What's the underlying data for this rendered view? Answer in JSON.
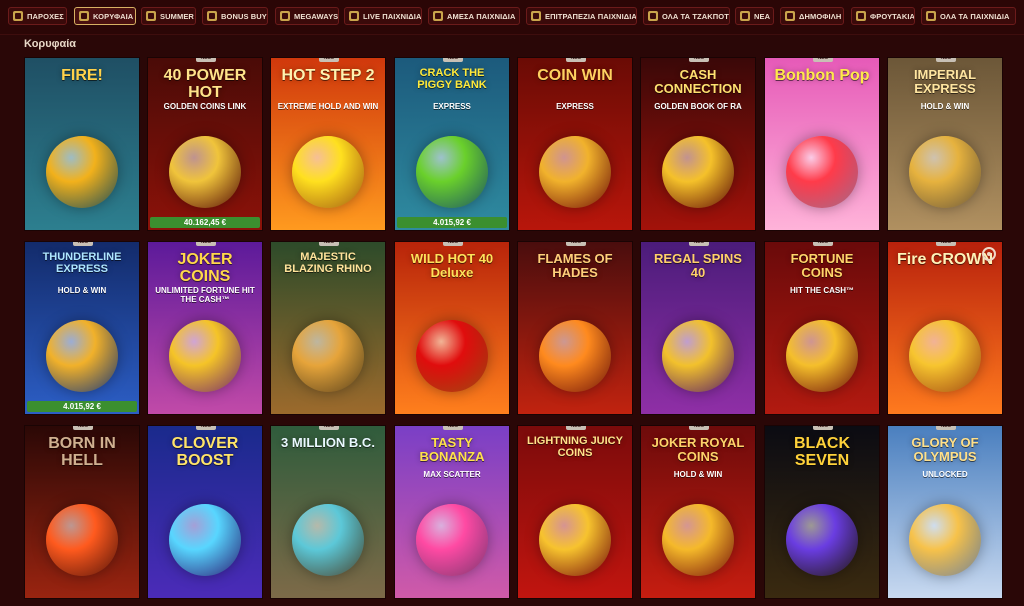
{
  "nav": {
    "tabs": [
      {
        "label": "ΠΑΡΟΧΕΣ",
        "icon": "grid-icon",
        "active": false
      },
      {
        "label": "ΚΟΡΥΦΑΙΑ",
        "icon": "crown-icon",
        "active": true
      },
      {
        "label": "SUMMER",
        "icon": "sun-icon",
        "active": false
      },
      {
        "label": "BONUS BUYS",
        "icon": "bonus-icon",
        "active": false
      },
      {
        "label": "MEGAWAYS",
        "icon": "megaways-icon",
        "active": false
      },
      {
        "label": "LIVE ΠΑΙΧΝΙΔΙΑ",
        "icon": "live-icon",
        "active": false
      },
      {
        "label": "ΑΜΕΣΑ ΠΑΙΧΝΙΔΙΑ",
        "icon": "instant-icon",
        "active": false
      },
      {
        "label": "ΕΠΙΤΡΑΠΕΖΙΑ ΠΑΙΧΝΙΔΙΑ",
        "icon": "table-games-icon",
        "active": false
      },
      {
        "label": "ΟΛΑ ΤΑ ΤΖΑΚΠΟΤ",
        "icon": "jackpot-icon",
        "active": false
      },
      {
        "label": "ΝΕΑ",
        "icon": "new-icon",
        "active": false
      },
      {
        "label": "ΔΗΜΟΦΙΛΗ",
        "icon": "popular-icon",
        "active": false
      },
      {
        "label": "ΦΡΟΥΤΑΚΙΑ",
        "icon": "fruit-icon",
        "active": false
      },
      {
        "label": "ΟΛΑ ΤΑ ΠΑΙΧΝΙΔΙΑ",
        "icon": "all-games-icon",
        "active": false
      }
    ]
  },
  "section": {
    "title": "Κορυφαία"
  },
  "games": [
    {
      "title": "FIRE!",
      "subtitle": "",
      "badge": "",
      "jackpot": "",
      "bg": [
        "#1f4f64",
        "#2d7f8f"
      ],
      "accent": "#f2b11b",
      "title_color": "#ffd24a"
    },
    {
      "title": "40 POWER HOT",
      "subtitle": "GOLDEN COINS LINK",
      "badge": "ΝΕΟ",
      "jackpot": "40.162,45 €",
      "bg": [
        "#4a0b07",
        "#8c1209"
      ],
      "accent": "#f0c43b",
      "title_color": "#ffe38a"
    },
    {
      "title": "HOT STEP 2",
      "subtitle": "EXTREME HOLD AND WIN",
      "badge": "ΝΕΟ",
      "jackpot": "",
      "bg": [
        "#d0380c",
        "#ff9a1f"
      ],
      "accent": "#ffe01f",
      "title_color": "#fff3b0"
    },
    {
      "title": "CRACK THE PIGGY BANK",
      "subtitle": "EXPRESS",
      "badge": "ΝΕΟ",
      "jackpot": "4.015,92 €",
      "bg": [
        "#1c5a7c",
        "#2f8ba0"
      ],
      "accent": "#6ad02b",
      "title_color": "#ffea3a"
    },
    {
      "title": "COIN WIN",
      "subtitle": "EXPRESS",
      "badge": "ΝΕΟ",
      "jackpot": "",
      "bg": [
        "#6a0b05",
        "#b8160b"
      ],
      "accent": "#f1b22c",
      "title_color": "#ffd060"
    },
    {
      "title": "CASH CONNECTION",
      "subtitle": "GOLDEN BOOK OF RA",
      "badge": "ΝΕΟ",
      "jackpot": "",
      "bg": [
        "#3a0808",
        "#a3120a"
      ],
      "accent": "#f5c12a",
      "title_color": "#ffe070"
    },
    {
      "title": "Bonbon Pop",
      "subtitle": "",
      "badge": "ΝΕΟ",
      "jackpot": "",
      "bg": [
        "#e65ab8",
        "#ffb3d9"
      ],
      "accent": "#ff3b4a",
      "title_color": "#ffe94a"
    },
    {
      "title": "IMPERIAL EXPRESS",
      "subtitle": "HOLD & WIN",
      "badge": "ΝΕΟ",
      "jackpot": "",
      "bg": [
        "#6c5738",
        "#b09060"
      ],
      "accent": "#e6b23e",
      "title_color": "#ffe5a0"
    },
    {
      "title": "THUNDERLINE EXPRESS",
      "subtitle": "HOLD & WIN",
      "badge": "ΝΕΟ",
      "jackpot": "4.015,92 €",
      "bg": [
        "#132b6b",
        "#2c5ec5"
      ],
      "accent": "#f1b12a",
      "title_color": "#aee6ff"
    },
    {
      "title": "JOKER COINS",
      "subtitle": "UNLIMITED FORTUNE HIT THE CASH™",
      "badge": "ΝΕΟ",
      "jackpot": "",
      "bg": [
        "#5c1a9a",
        "#c14aa8"
      ],
      "accent": "#f5c427",
      "title_color": "#ffd84a"
    },
    {
      "title": "MAJESTIC BLAZING RHINO",
      "subtitle": "",
      "badge": "ΝΕΟ",
      "jackpot": "",
      "bg": [
        "#2d4b2a",
        "#9c6a2c"
      ],
      "accent": "#e6a43a",
      "title_color": "#ffe39a"
    },
    {
      "title": "WILD HOT 40 Deluxe",
      "subtitle": "",
      "badge": "ΝΕΟ",
      "jackpot": "",
      "bg": [
        "#b8240a",
        "#ff7f1d"
      ],
      "accent": "#e00d0d",
      "title_color": "#ffe25a"
    },
    {
      "title": "FLAMES OF HADES",
      "subtitle": "",
      "badge": "ΝΕΟ",
      "jackpot": "",
      "bg": [
        "#4a0d0d",
        "#c1230f"
      ],
      "accent": "#ff8a1e",
      "title_color": "#ffcf7a"
    },
    {
      "title": "REGAL SPINS 40",
      "subtitle": "",
      "badge": "ΝΕΟ",
      "jackpot": "",
      "bg": [
        "#4b1c7a",
        "#8f2fa6"
      ],
      "accent": "#f2c12c",
      "title_color": "#ffd06a"
    },
    {
      "title": "FORTUNE COINS",
      "subtitle": "HIT THE CASH™",
      "badge": "ΝΕΟ",
      "jackpot": "",
      "bg": [
        "#6a0a0a",
        "#b21a10"
      ],
      "accent": "#f5bf2b",
      "title_color": "#ffd56a"
    },
    {
      "title": "Fire CROWN",
      "subtitle": "",
      "badge": "ΝΕΟ",
      "jackpot": "",
      "bg": [
        "#b8210c",
        "#ff7a1e"
      ],
      "accent": "#f7c52f",
      "title_color": "#fff2b8"
    },
    {
      "title": "BORN IN HELL",
      "subtitle": "",
      "badge": "ΝΕΟ",
      "jackpot": "",
      "bg": [
        "#2b0806",
        "#9a2410"
      ],
      "accent": "#ff5a1e",
      "title_color": "#d0b090"
    },
    {
      "title": "CLOVER BOOST",
      "subtitle": "",
      "badge": "ΝΕΟ",
      "jackpot": "",
      "bg": [
        "#1a2a8c",
        "#4b2bb8"
      ],
      "accent": "#58d6ff",
      "title_color": "#ffe46a"
    },
    {
      "title": "3 MILLION B.C.",
      "subtitle": "",
      "badge": "ΝΕΟ",
      "jackpot": "",
      "bg": [
        "#2f5c3c",
        "#7d6a48"
      ],
      "accent": "#5cc8d8",
      "title_color": "#eaf8ff"
    },
    {
      "title": "TASTY BONANZA",
      "subtitle": "MAX SCATTER",
      "badge": "ΝΕΟ",
      "jackpot": "",
      "bg": [
        "#7a3fc6",
        "#d05aa8"
      ],
      "accent": "#ff4aa3",
      "title_color": "#ffe24a"
    },
    {
      "title": "LIGHTNING JUICY COINS",
      "subtitle": "",
      "badge": "ΝΕΟ",
      "jackpot": "",
      "bg": [
        "#7b0b0b",
        "#c1150f"
      ],
      "accent": "#f7c32e",
      "title_color": "#ffe28a"
    },
    {
      "title": "JOKER ROYAL COINS",
      "subtitle": "HOLD & WIN",
      "badge": "ΝΕΟ",
      "jackpot": "",
      "bg": [
        "#6d0b0b",
        "#c61d10"
      ],
      "accent": "#f5b92a",
      "title_color": "#ffd36a"
    },
    {
      "title": "BLACK SEVEN",
      "subtitle": "",
      "badge": "ΝΕΟ",
      "jackpot": "",
      "bg": [
        "#0b0b12",
        "#3a2a10"
      ],
      "accent": "#6a3de1",
      "title_color": "#ffd23a"
    },
    {
      "title": "GLORY OF OLYMPUS",
      "subtitle": "UNLOCKED",
      "badge": "ΝΕΟ",
      "jackpot": "",
      "bg": [
        "#4a7fbf",
        "#c8d9f0"
      ],
      "accent": "#f7c24a",
      "title_color": "#ffe08a"
    }
  ]
}
